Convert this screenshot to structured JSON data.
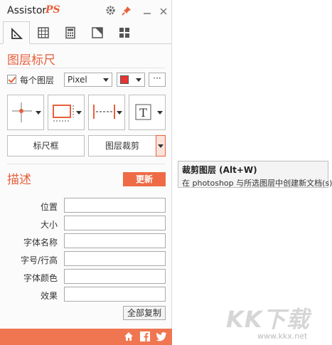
{
  "app": {
    "title_main": "Assistor",
    "title_accent": "PS"
  },
  "window": {
    "settings_icon": "gear-icon",
    "pin_icon": "pin-icon",
    "minimize_icon": "minimize-icon",
    "close_icon": "close-icon"
  },
  "tabs": [
    {
      "icon": "ruler-triangle-icon",
      "active": true
    },
    {
      "icon": "grid-icon",
      "active": false
    },
    {
      "icon": "calculator-icon",
      "active": false
    },
    {
      "icon": "crop-corner-icon",
      "active": false
    },
    {
      "icon": "four-squares-icon",
      "active": false
    }
  ],
  "ruler": {
    "heading": "图层标尺",
    "each_layer_label": "每个图层",
    "each_layer_checked": true,
    "unit_value": "Pixel",
    "color": "#e83434",
    "more_label": "···",
    "tools": [
      "crosshair-marker-icon",
      "rectangle-dashed-icon",
      "horizontal-ruler-icon",
      "text-tool-icon"
    ],
    "frame_button": "标尺框",
    "crop_button": "图层裁剪"
  },
  "tooltip": {
    "title": "裁剪图层 (Alt+W)",
    "description": "在 photoshop 与所选图层中创建新文档(s)."
  },
  "describe": {
    "heading": "描述",
    "update_button": "更新",
    "fields": [
      {
        "label": "位置",
        "value": ""
      },
      {
        "label": "大小",
        "value": ""
      },
      {
        "label": "字体名称",
        "value": ""
      },
      {
        "label": "字号/行高",
        "value": ""
      },
      {
        "label": "字体颜色",
        "value": ""
      },
      {
        "label": "效果",
        "value": ""
      }
    ],
    "copy_all_button": "全部复制"
  },
  "footer": {
    "icons": [
      "home-icon",
      "facebook-icon",
      "twitter-icon"
    ]
  },
  "watermark": {
    "logo": "KK下载",
    "url": "www.kkx.net"
  },
  "colors": {
    "accent": "#e8603c",
    "footer": "#f07651",
    "update": "#ee6b45"
  }
}
